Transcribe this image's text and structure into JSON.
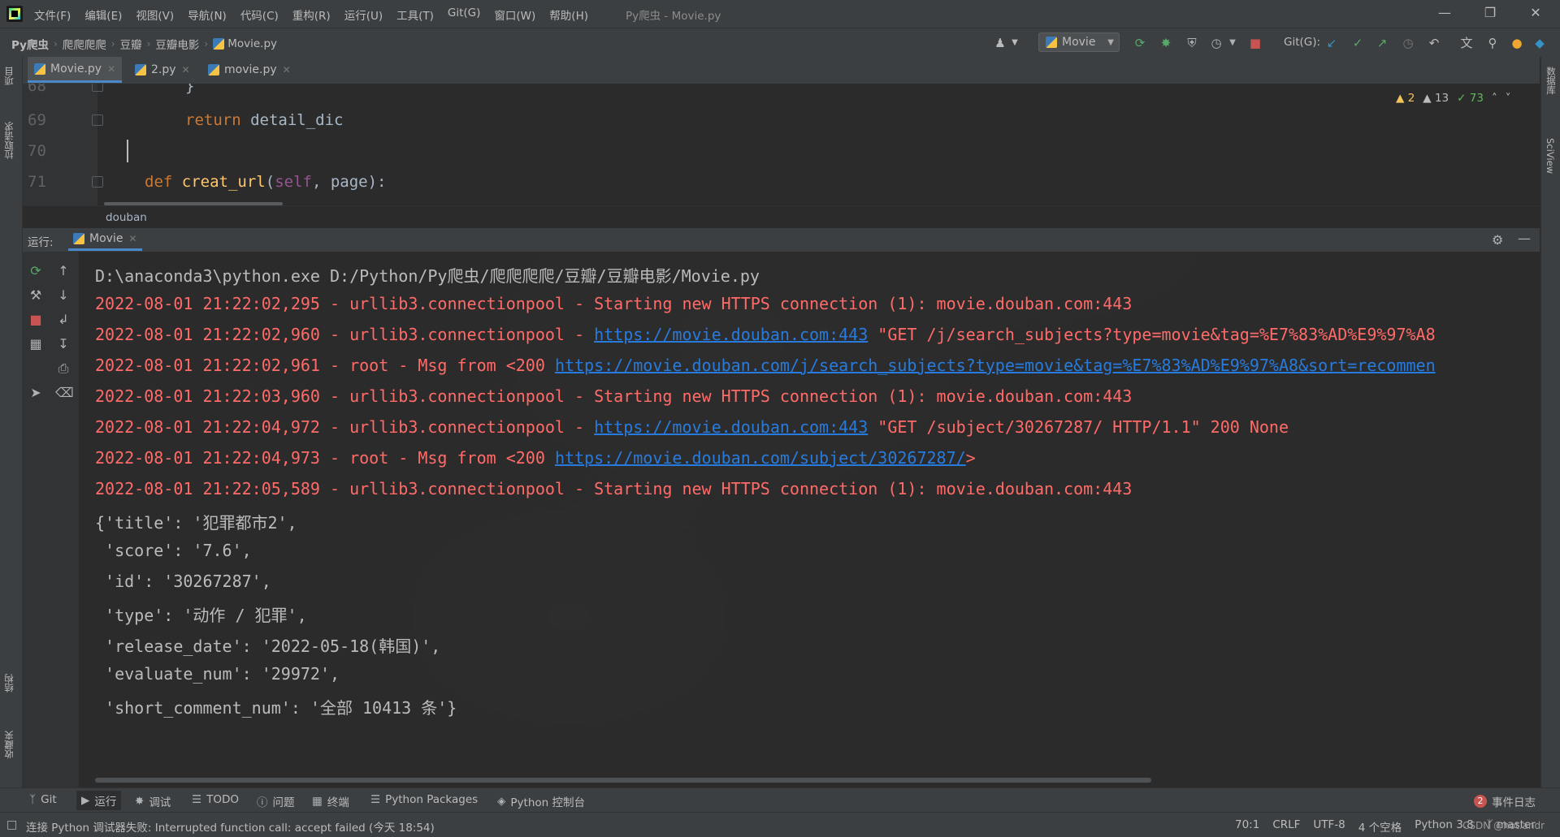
{
  "app": {
    "title": "Py爬虫 - Movie.py",
    "menu": [
      "文件(F)",
      "编辑(E)",
      "视图(V)",
      "导航(N)",
      "代码(C)",
      "重构(R)",
      "运行(U)",
      "工具(T)",
      "Git(G)",
      "窗口(W)",
      "帮助(H)"
    ]
  },
  "breadcrumb": [
    "Py爬虫",
    "爬爬爬爬",
    "豆瓣",
    "豆瓣电影",
    "Movie.py"
  ],
  "toolbar": {
    "run_config": "Movie",
    "git_label": "Git(G):"
  },
  "left_strip": {
    "top": "项目",
    "middle": "拉取请求",
    "bottom1": "结构",
    "bottom2": "收藏夹"
  },
  "right_strip": {
    "top": "数据库",
    "bottom": "SciView"
  },
  "editor_tabs": [
    {
      "label": "Movie.py"
    },
    {
      "label": "2.py"
    },
    {
      "label": "movie.py"
    }
  ],
  "editor": {
    "lines": [
      {
        "num": "68",
        "text": "}"
      },
      {
        "num": "69",
        "kw": "return",
        "rest": " detail_dic"
      },
      {
        "num": "70",
        "text": ""
      },
      {
        "num": "71",
        "kw": "def",
        "fn": "creat_url",
        "self": "self",
        "rest": ", page):"
      }
    ],
    "inspections": {
      "warnings": "2",
      "weak": "13",
      "ok": "73"
    },
    "breadcrumb": "douban"
  },
  "run_panel": {
    "label": "运行:",
    "tab": "Movie",
    "console": [
      {
        "type": "cmd",
        "text": "D:\\anaconda3\\python.exe D:/Python/Py爬虫/爬爬爬爬/豆瓣/豆瓣电影/Movie.py"
      },
      {
        "type": "err",
        "text": "2022-08-01 21:22:02,295 - urllib3.connectionpool - Starting new HTTPS connection (1): movie.douban.com:443"
      },
      {
        "type": "err-url",
        "pre": "2022-08-01 21:22:02,960 - urllib3.connectionpool - ",
        "url": "https://movie.douban.com:443",
        "post": " \"GET /j/search_subjects?type=movie&tag=%E7%83%AD%E9%97%A8"
      },
      {
        "type": "err-url",
        "pre": "2022-08-01 21:22:02,961 - root - Msg from <200 ",
        "url": "https://movie.douban.com/j/search_subjects?type=movie&tag=%E7%83%AD%E9%97%A8&sort=recommen",
        "post": ""
      },
      {
        "type": "err",
        "text": "2022-08-01 21:22:03,960 - urllib3.connectionpool - Starting new HTTPS connection (1): movie.douban.com:443"
      },
      {
        "type": "err-url",
        "pre": "2022-08-01 21:22:04,972 - urllib3.connectionpool - ",
        "url": "https://movie.douban.com:443",
        "post": " \"GET /subject/30267287/ HTTP/1.1\" 200 None"
      },
      {
        "type": "err-url",
        "pre": "2022-08-01 21:22:04,973 - root - Msg from <200 ",
        "url": "https://movie.douban.com/subject/30267287/",
        "post": ">"
      },
      {
        "type": "err",
        "text": "2022-08-01 21:22:05,589 - urllib3.connectionpool - Starting new HTTPS connection (1): movie.douban.com:443"
      },
      {
        "type": "out",
        "text": "{'title': '犯罪都市2',"
      },
      {
        "type": "out",
        "text": " 'score': '7.6',"
      },
      {
        "type": "out",
        "text": " 'id': '30267287',"
      },
      {
        "type": "out",
        "text": " 'type': '动作 / 犯罪',"
      },
      {
        "type": "out",
        "text": " 'release_date': '2022-05-18(韩国)',"
      },
      {
        "type": "out",
        "text": " 'evaluate_num': '29972',"
      },
      {
        "type": "out",
        "text": " 'short_comment_num': '全部 10413 条'}"
      }
    ]
  },
  "bottom_tabs": [
    "Git",
    "运行",
    "调试",
    "TODO",
    "问题",
    "终端",
    "Python Packages",
    "Python 控制台"
  ],
  "event_log": {
    "count": "2",
    "label": "事件日志"
  },
  "status": {
    "message": "连接 Python 调试器失败: Interrupted function call: accept failed (今天 18:54)",
    "position": "70:1",
    "line_sep": "CRLF",
    "encoding": "UTF-8",
    "indent": "4 个空格",
    "interpreter": "Python 3.8",
    "branch": "master",
    "watermark": "CSDN @hot.andr"
  },
  "colors": {
    "error_text": "#ff6b68",
    "link": "#287bde",
    "keyword": "#cc7832",
    "function": "#ffc66d",
    "self": "#94558d",
    "accent": "#4a88c7"
  }
}
